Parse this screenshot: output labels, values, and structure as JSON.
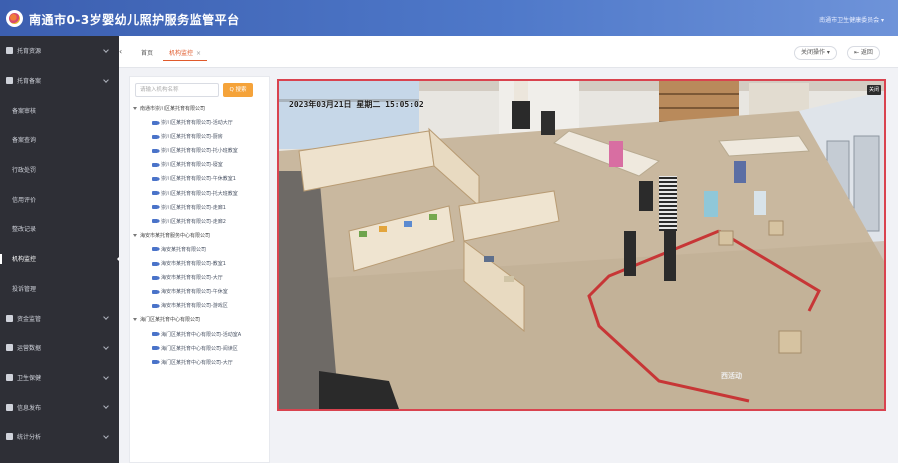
{
  "app": {
    "title": "南通市0-3岁婴幼儿照护服务监管平台",
    "user_info": "南通市卫生健康委员会 ▾"
  },
  "sidebar": {
    "items": [
      {
        "label": "托育资源",
        "icon": "building-icon",
        "level": 1,
        "expandable": true
      },
      {
        "label": "托育备案",
        "icon": "document-icon",
        "level": 1,
        "expandable": true
      },
      {
        "label": "备案审核",
        "icon": "",
        "level": 2,
        "expandable": false
      },
      {
        "label": "备案查询",
        "icon": "",
        "level": 2,
        "expandable": false
      },
      {
        "label": "行政处罚",
        "icon": "",
        "level": 2,
        "expandable": false
      },
      {
        "label": "信用评价",
        "icon": "",
        "level": 2,
        "expandable": false
      },
      {
        "label": "整改记录",
        "icon": "",
        "level": 2,
        "expandable": false
      },
      {
        "label": "机构监控",
        "icon": "",
        "level": 2,
        "expandable": false,
        "active": true
      },
      {
        "label": "投诉管理",
        "icon": "",
        "level": 2,
        "expandable": false
      },
      {
        "label": "资金监管",
        "icon": "yuan-icon",
        "level": 1,
        "expandable": true
      },
      {
        "label": "运营数据",
        "icon": "card-icon",
        "level": 1,
        "expandable": true
      },
      {
        "label": "卫生保健",
        "icon": "board-icon",
        "level": 1,
        "expandable": true
      },
      {
        "label": "信息发布",
        "icon": "folder-icon",
        "level": 1,
        "expandable": true
      },
      {
        "label": "统计分析",
        "icon": "chart-icon",
        "level": 1,
        "expandable": true
      },
      {
        "label": "系统设置",
        "icon": "gear-icon",
        "level": 1,
        "expandable": false
      }
    ]
  },
  "tabs": {
    "home_label": "首页",
    "current_label": "机构监控",
    "close_glyph": "×"
  },
  "toolbar": {
    "ops_label": "关闭操作 ▾",
    "back_label": "⇤ 返回"
  },
  "tree": {
    "search_placeholder": "请输入机构名称",
    "search_button": "Q 搜索",
    "nodes": [
      {
        "type": "group",
        "label": "南通市崇川区某托育有限公司"
      },
      {
        "type": "leaf",
        "label": "崇川区某托育有限公司-活动大厅"
      },
      {
        "type": "leaf",
        "label": "崇川区某托育有限公司-厨房"
      },
      {
        "type": "leaf",
        "label": "崇川区某托育有限公司-托小班教室"
      },
      {
        "type": "leaf",
        "label": "崇川区某托育有限公司-寝室"
      },
      {
        "type": "leaf",
        "label": "崇川区某托育有限公司-午休教室1"
      },
      {
        "type": "leaf",
        "label": "崇川区某托育有限公司-托大班教室"
      },
      {
        "type": "leaf",
        "label": "崇川区某托育有限公司-走廊1"
      },
      {
        "type": "leaf",
        "label": "崇川区某托育有限公司-走廊2"
      },
      {
        "type": "group",
        "label": "海安市某托育服务中心有限公司"
      },
      {
        "type": "leaf",
        "label": "海安某托育有限公司"
      },
      {
        "type": "leaf",
        "label": "海安市某托育有限公司-教室1"
      },
      {
        "type": "leaf",
        "label": "海安市某托育有限公司-大厅"
      },
      {
        "type": "leaf",
        "label": "海安市某托育有限公司-午休室"
      },
      {
        "type": "leaf",
        "label": "海安市某托育有限公司-游戏区"
      },
      {
        "type": "group",
        "label": "海门区某托育中心有限公司"
      },
      {
        "type": "leaf",
        "label": "海门区某托育中心有限公司-活动室A"
      },
      {
        "type": "leaf",
        "label": "海门区某托育中心有限公司-阅读区"
      },
      {
        "type": "leaf",
        "label": "海门区某托育中心有限公司-大厅"
      }
    ]
  },
  "video": {
    "timestamp": "2023年03月21日 星期二 15:05:02",
    "camera_label": "西活动",
    "close_label": "关闭",
    "border_color": "#d9434f"
  },
  "colors": {
    "header_blue": "#3c5fb0",
    "sidebar_bg": "#2e2f36",
    "accent_orange": "#e05a2b",
    "search_orange": "#f5a33a",
    "tree_icon_blue": "#4a73c9"
  }
}
